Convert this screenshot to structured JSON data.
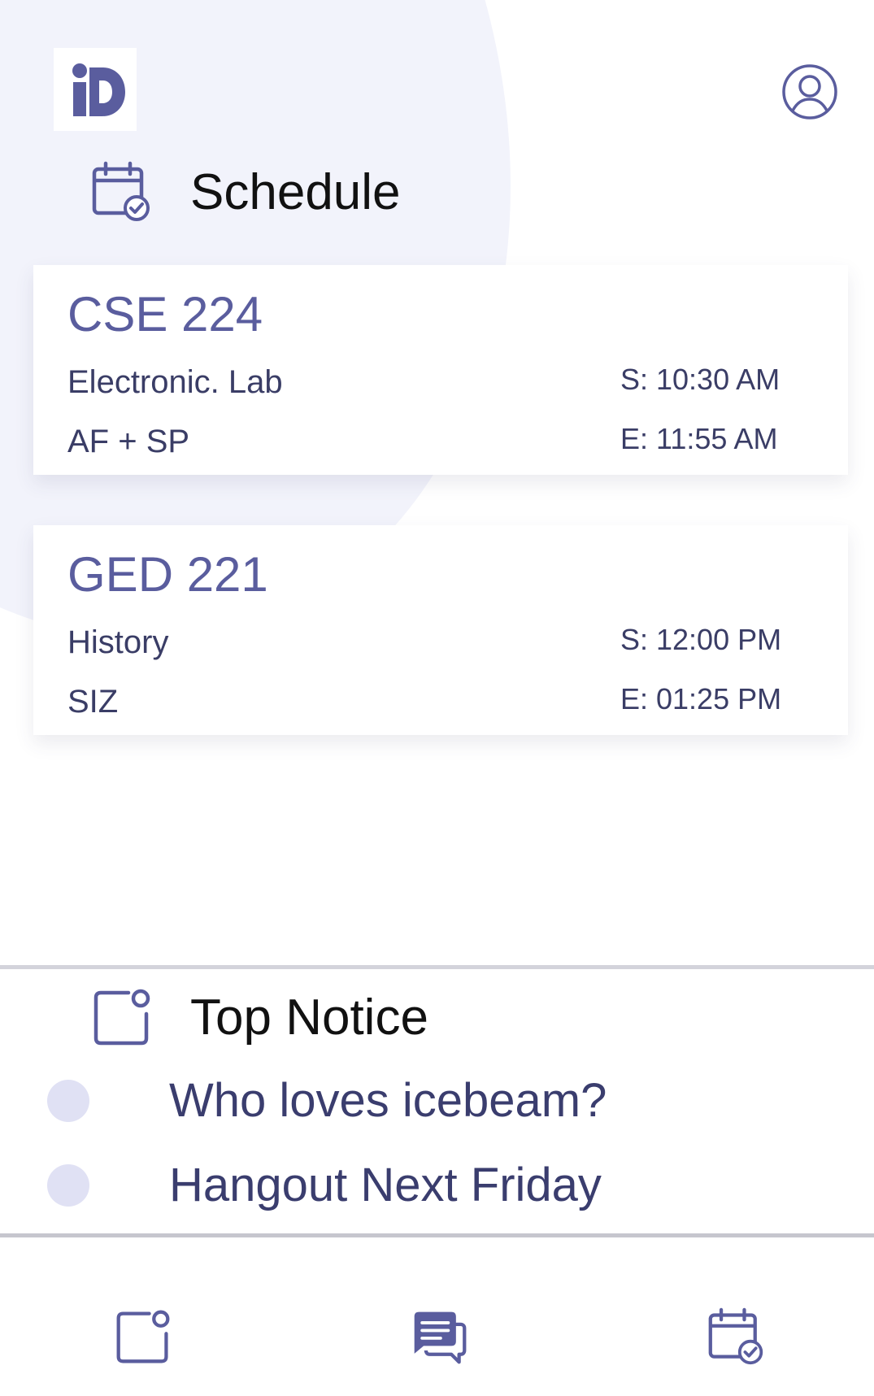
{
  "app": {
    "logo_text": "iD",
    "accent_color": "#5a5d9e",
    "icons": {
      "profile": "user-circle-icon",
      "schedule": "calendar-check-icon",
      "notice": "notice-card-icon",
      "chat": "chat-bubbles-icon"
    }
  },
  "schedule": {
    "title": "Schedule",
    "classes": [
      {
        "course": "CSE 224",
        "name": "Electronic. Lab",
        "instructor": "AF + SP",
        "start": "S: 10:30 AM",
        "end": "E: 11:55 AM"
      },
      {
        "course": "GED 221",
        "name": "History",
        "instructor": "SIZ",
        "start": "S: 12:00 PM",
        "end": "E: 01:25 PM"
      }
    ]
  },
  "notices": {
    "title": "Top Notice",
    "items": [
      "Who loves icebeam?",
      "Hangout Next Friday"
    ]
  }
}
